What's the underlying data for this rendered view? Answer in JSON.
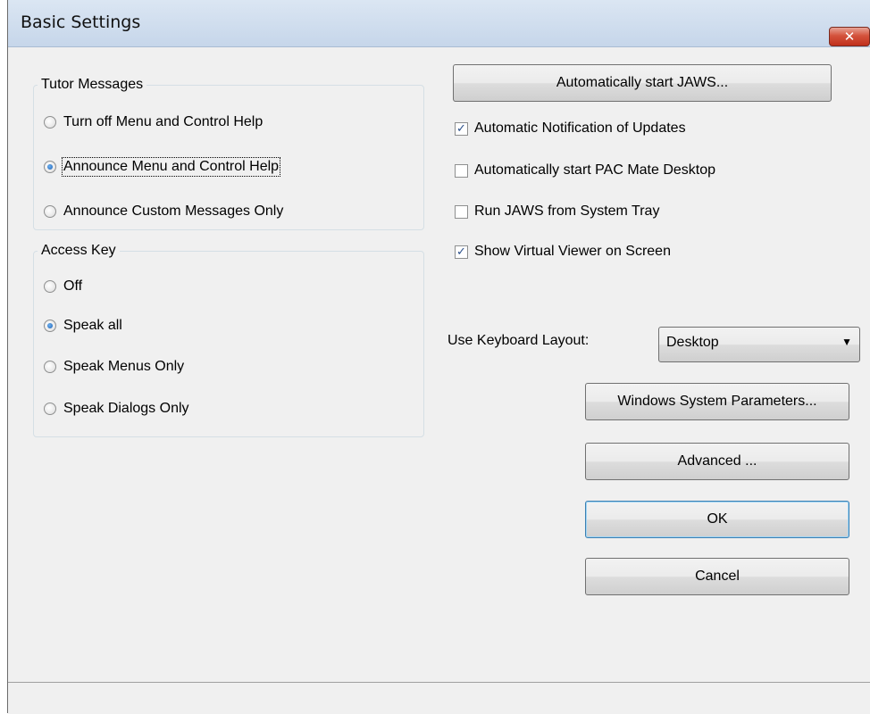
{
  "window": {
    "title": "Basic Settings",
    "close_glyph": "✕"
  },
  "tutor": {
    "legend": "Tutor Messages",
    "options": [
      {
        "label": "Turn off Menu and Control Help",
        "checked": false
      },
      {
        "label": "Announce Menu and Control Help",
        "checked": true
      },
      {
        "label": "Announce Custom Messages Only",
        "checked": false
      }
    ]
  },
  "access_key": {
    "legend": "Access Key",
    "options": [
      {
        "label": "Off",
        "checked": false
      },
      {
        "label": "Speak all",
        "checked": true
      },
      {
        "label": "Speak Menus Only",
        "checked": false
      },
      {
        "label": "Speak Dialogs Only",
        "checked": false
      }
    ]
  },
  "buttons": {
    "auto_start": "Automatically start JAWS...",
    "windows_params": "Windows System Parameters...",
    "advanced": "Advanced ...",
    "ok": "OK",
    "cancel": "Cancel"
  },
  "checkboxes": [
    {
      "label": "Automatic Notification of Updates",
      "checked": true
    },
    {
      "label": "Automatically start PAC Mate Desktop",
      "checked": false
    },
    {
      "label": "Run JAWS from System Tray",
      "checked": false
    },
    {
      "label": "Show Virtual Viewer on Screen",
      "checked": true
    }
  ],
  "keyboard": {
    "label": "Use Keyboard Layout:",
    "value": "Desktop"
  },
  "check_glyph": "✓",
  "dropdown_glyph": "▼"
}
